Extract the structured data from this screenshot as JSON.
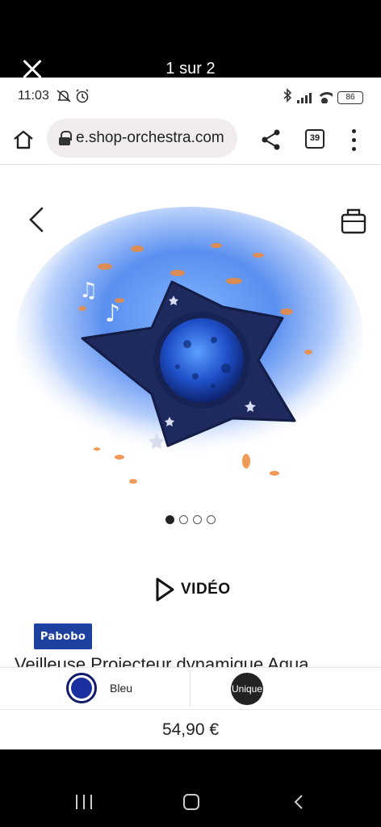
{
  "viewer": {
    "counter": "1 sur 2"
  },
  "status_bar": {
    "time": "11:03",
    "battery": "86"
  },
  "browser": {
    "url": "e.shop-orchestra.com",
    "tab_count": "39"
  },
  "gallery": {
    "dot_count": 4,
    "active_dot": 0
  },
  "product": {
    "video_label": "VIDÉO",
    "brand_logo": "Pabobo",
    "title": "Veilleuse Projecteur dynamique Aqua"
  },
  "options": {
    "color_label": "Bleu",
    "size_label": "Unique",
    "swatch_color": "#1a2fa0"
  },
  "price": "54,90 €",
  "colors": {
    "accent_dark": "#111111",
    "brand_blue": "#1d3fa0",
    "star_navy": "#1e2a5e"
  }
}
